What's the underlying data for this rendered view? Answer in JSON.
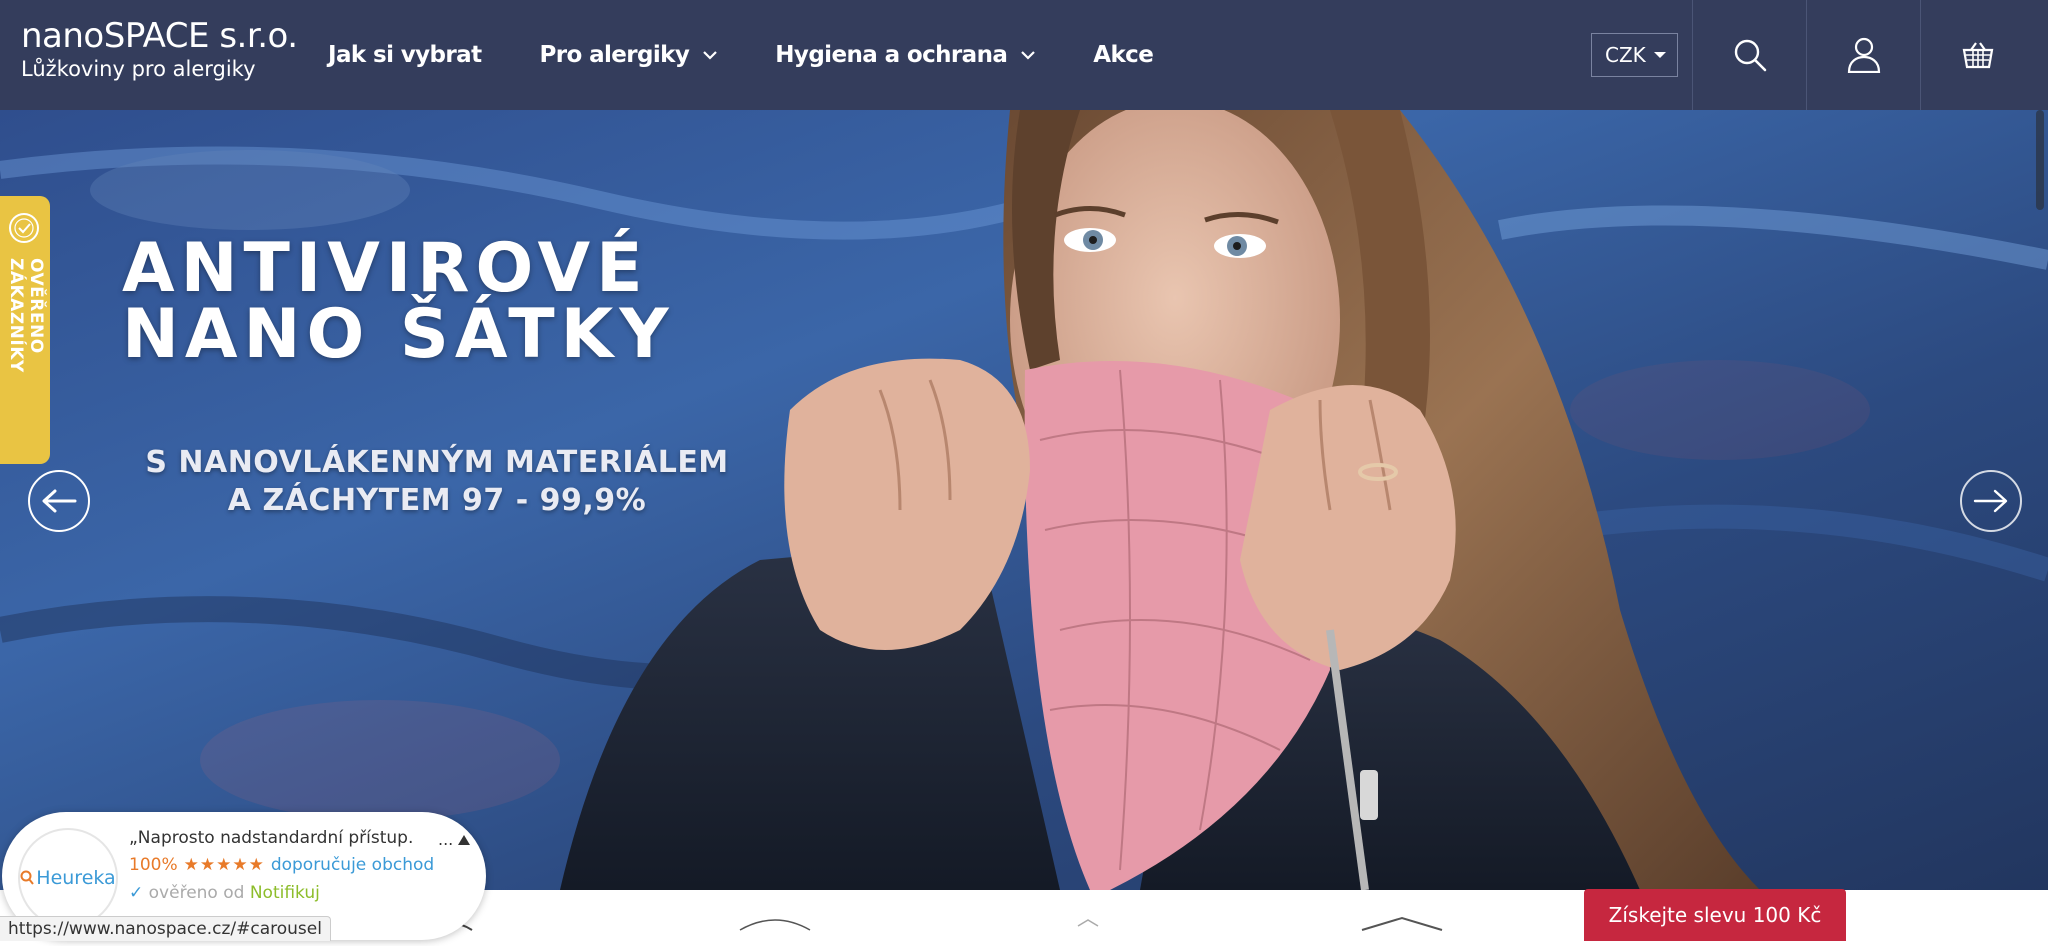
{
  "brand": {
    "name": "nanoSPACE s.r.o.",
    "tagline": "Lůžkoviny pro alergiky"
  },
  "nav": {
    "items": [
      {
        "label": "Jak si vybrat",
        "dropdown": false
      },
      {
        "label": "Pro alergiky",
        "dropdown": true
      },
      {
        "label": "Hygiena a ochrana",
        "dropdown": true
      },
      {
        "label": "Akce",
        "dropdown": false
      }
    ]
  },
  "header": {
    "currency": "CZK",
    "icons": [
      "search-icon",
      "user-icon",
      "basket-icon"
    ]
  },
  "hero": {
    "title_line1": "ANTIVIROVÉ",
    "title_line2": "NANO ŠÁTKY",
    "subtitle_line1": "S NANOVLÁKENNÝM MATERIÁLEM",
    "subtitle_line2": "A ZÁCHYTEM 97 - 99,9%"
  },
  "verified_tab": {
    "label": "OVĚŘENO ZÁKAZNÍKY"
  },
  "heureka": {
    "logo_text": "Heureka",
    "quote": "„Naprosto nadstandardní přístup.",
    "more": "...",
    "percent": "100%",
    "stars": "★★★★★",
    "recommend": "doporučuje obchod",
    "check": "✓",
    "verified_by": "ověřeno od",
    "verifier": "Notifikuj"
  },
  "discount": {
    "label": "Získejte slevu 100 Kč"
  },
  "status_bar": {
    "url": "https://www.nanospace.cz/#carousel"
  },
  "colors": {
    "header_bg": "#343d5c",
    "discount_bg": "#c6273f",
    "verified_tab_bg": "#e9c443",
    "heureka_orange": "#e87a29",
    "heureka_blue": "#3b9ad7"
  }
}
